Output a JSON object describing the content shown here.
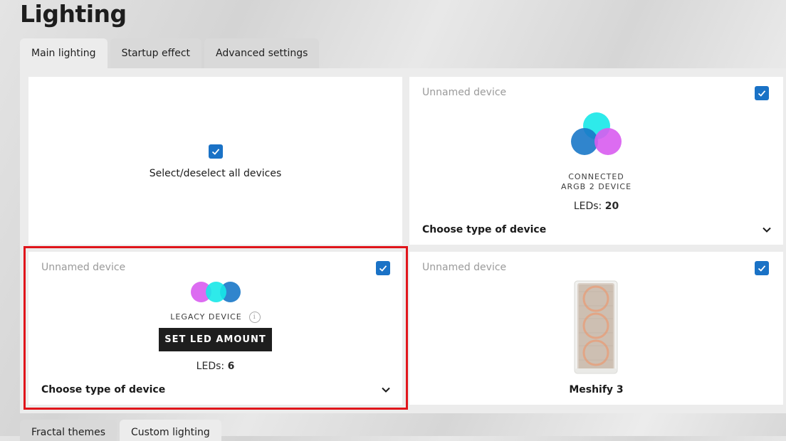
{
  "page": {
    "title": "Lighting"
  },
  "tabs": [
    {
      "label": "Main lighting",
      "active": true
    },
    {
      "label": "Startup effect",
      "active": false
    },
    {
      "label": "Advanced settings",
      "active": false
    }
  ],
  "select_all": {
    "label": "Select/deselect all devices",
    "checked": true
  },
  "devices": [
    {
      "name": "Unnamed device",
      "checked": true,
      "type_line1": "CONNECTED",
      "type_line2": "ARGB 2 DEVICE",
      "leds_label": "LEDs:",
      "leds_value": "20",
      "choose_label": "Choose type of device",
      "icon": "argb-circles-icon"
    },
    {
      "name": "Unnamed device",
      "checked": true,
      "type_line1": "LEGACY DEVICE",
      "button_label": "SET LED AMOUNT",
      "leds_label": "LEDs:",
      "leds_value": "6",
      "choose_label": "Choose type of device",
      "icon": "legacy-circles-icon"
    },
    {
      "name": "Unnamed device",
      "checked": true,
      "product_name": "Meshify 3",
      "icon": "pc-case-image"
    }
  ],
  "bottom_tabs": [
    {
      "label": "Fractal themes"
    },
    {
      "label": "Custom lighting"
    }
  ],
  "colors": {
    "accent": "#1a72c6",
    "highlight": "#e0151b",
    "cyan": "#17e8e8",
    "magenta": "#d85cf0",
    "blue": "#1a78c8"
  }
}
